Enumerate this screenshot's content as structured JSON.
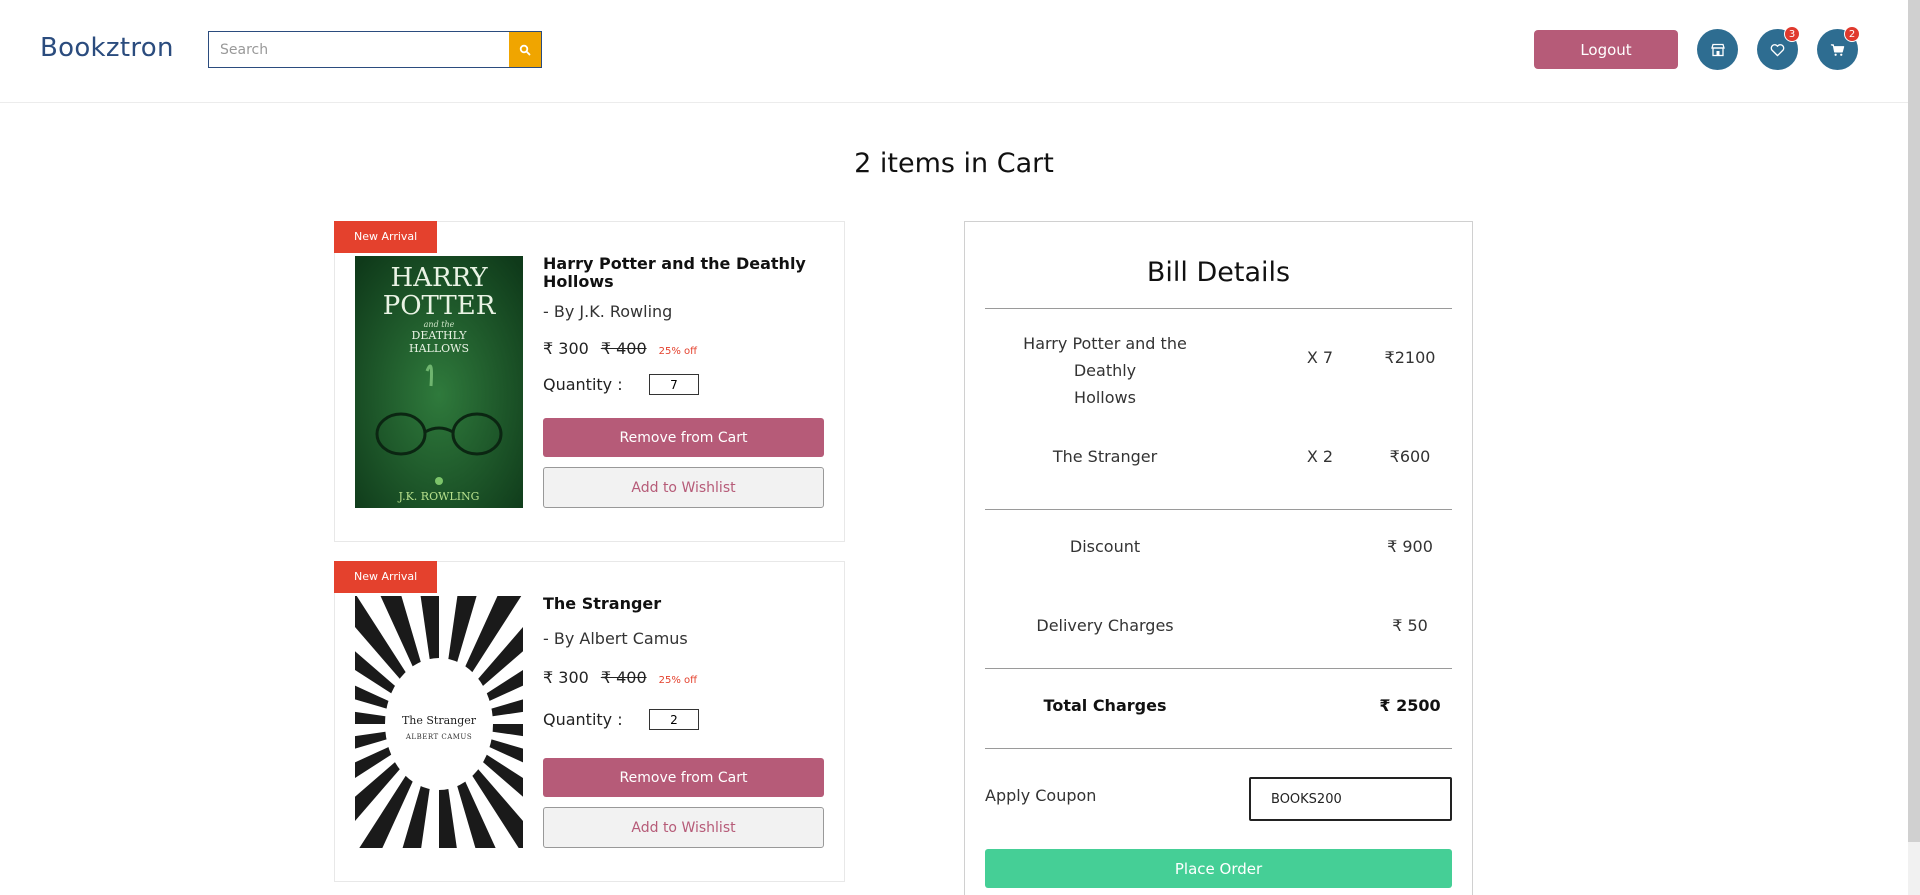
{
  "header": {
    "logo": "Bookztron",
    "search_placeholder": "Search",
    "logout_label": "Logout",
    "wishlist_count": "3",
    "cart_count": "2"
  },
  "page_title": "2 items in Cart",
  "cart_items": [
    {
      "ribbon": "New Arrival",
      "title": "Harry Potter and the Deathly Hollows",
      "author": "- By  J.K. Rowling",
      "price": "₹ 300",
      "old_price": "₹ 400",
      "discount": "25% off",
      "qty_label": "Quantity :",
      "qty": "7",
      "remove_label": "Remove from Cart",
      "wishlist_label": "Add to Wishlist",
      "cover": {
        "line1": "HARRY",
        "line2": "POTTER",
        "line3": "and the",
        "line4": "DEATHLY",
        "line5": "HALLOWS",
        "author": "J.K. ROWLING",
        "bg": "#1f5a2c"
      }
    },
    {
      "ribbon": "New Arrival",
      "title": "The Stranger",
      "author": "- By  Albert Camus",
      "price": "₹ 300",
      "old_price": "₹ 400",
      "discount": "25% off",
      "qty_label": "Quantity :",
      "qty": "2",
      "remove_label": "Remove from Cart",
      "wishlist_label": "Add to Wishlist",
      "cover": {
        "title": "The Stranger",
        "author": "ALBERT CAMUS"
      }
    }
  ],
  "bill": {
    "title": "Bill Details",
    "lines": [
      {
        "name_line1": "Harry Potter and the Deathly",
        "name_line2": "Hollows",
        "qty": "X 7",
        "amount": "₹2100"
      },
      {
        "name": "The Stranger",
        "qty": "X 2",
        "amount": "₹600"
      }
    ],
    "discount_label": "Discount",
    "discount_value": "₹ 900",
    "delivery_label": "Delivery Charges",
    "delivery_value": "₹ 50",
    "total_label": "Total Charges",
    "total_value": "₹ 2500",
    "coupon_label": "Apply Coupon",
    "coupon_value": "BOOKS200",
    "place_order_label": "Place Order"
  },
  "colors": {
    "brand": "#2b4c7e",
    "accent_rose": "#b65b78",
    "search_button": "#f0a500",
    "icon_button": "#2e6d91",
    "ribbon": "#e4412d",
    "place_order": "#45cf96"
  },
  "icons": {
    "search": "search-icon",
    "store": "store-icon",
    "wishlist": "heart-icon",
    "cart": "cart-icon"
  }
}
